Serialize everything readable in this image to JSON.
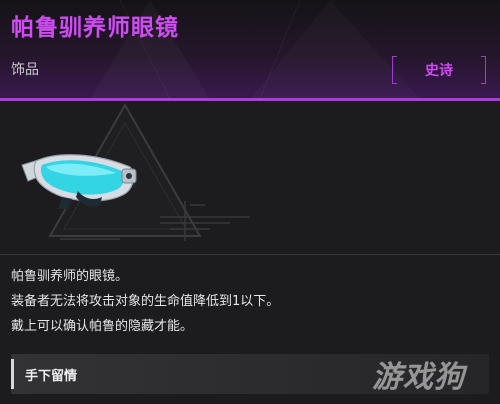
{
  "item": {
    "name": "帕鲁驯养师眼镜",
    "category": "饰品",
    "rarity": "史诗",
    "rarity_color": "#cf4cf4",
    "image_icon": "goggles-icon"
  },
  "description": {
    "lines": [
      "帕鲁驯养师的眼镜。",
      "装备者无法将攻击对象的生命值降低到1以下。",
      "戴上可以确认帕鲁的隐藏才能。"
    ]
  },
  "passive_section": {
    "label": "手下留情"
  },
  "watermark": {
    "text": "游戏狗"
  },
  "colors": {
    "accent": "#b03ae0",
    "background": "#1c1c1e"
  }
}
